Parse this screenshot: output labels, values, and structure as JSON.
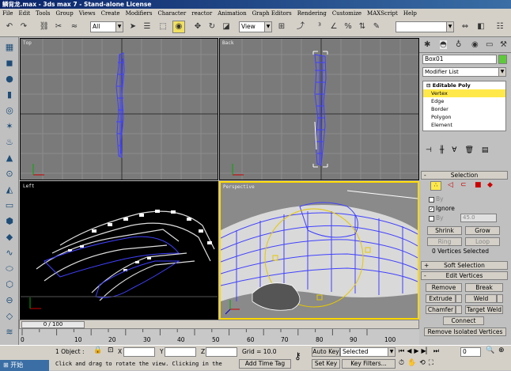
{
  "title": "鳞背龙.max - 3ds max 7 - Stand-alone License",
  "menu": [
    "File",
    "Edit",
    "Tools",
    "Group",
    "Views",
    "Create",
    "Modifiers",
    "Character",
    "reactor",
    "Animation",
    "Graph Editors",
    "Rendering",
    "Customize",
    "MAXScript",
    "Help"
  ],
  "toolbar": {
    "selection_filter": "All",
    "ref_coord": "View"
  },
  "viewports": {
    "top": "Top",
    "back": "Back",
    "left": "Left",
    "perspective": "Perspective"
  },
  "time": {
    "slider": "0 / 100",
    "ticks": [
      "0",
      "10",
      "20",
      "30",
      "40",
      "50",
      "60",
      "70",
      "80",
      "90",
      "100"
    ]
  },
  "status": {
    "selection_count": "1 Object",
    "x_label": "X",
    "y_label": "Y",
    "z_label": "Z",
    "grid": "Grid = 10.0",
    "autokey": "Auto Key",
    "setkey": "Set Key",
    "selected_dropdown": "Selected",
    "key_filters": "Key Filters...",
    "prompt": "Click and drag to rotate the view.  Clicking in the",
    "add_time_tag": "Add Time Tag",
    "frame": "0",
    "start_label": "开始"
  },
  "command_panel": {
    "object_name": "Box01",
    "modifier_list": "Modifier List",
    "stack": [
      "Editable Poly",
      "Vertex",
      "Edge",
      "Border",
      "Polygon",
      "Element"
    ],
    "selection_rollout": "Selection",
    "by_vertex": "By",
    "ignore": "Ignore",
    "by_angle": "By",
    "angle_value": "45.0",
    "shrink": "Shrink",
    "grow": "Grow",
    "ring": "Ring",
    "loop": "Loop",
    "selected_info": "0 Vertices Selected",
    "soft_selection": "Soft Selection",
    "edit_vertices": "Edit Vertices",
    "remove": "Remove",
    "break": "Break",
    "extrude": "Extrude",
    "weld": "Weld",
    "chamfer": "Chamfer",
    "target_weld": "Target Weld",
    "connect": "Connect",
    "remove_isolated": "Remove Isolated Vertices"
  },
  "colors": {
    "accent": "#ffe94a",
    "wire": "#5050ff",
    "viewport_bg": "#7a7a7a"
  }
}
